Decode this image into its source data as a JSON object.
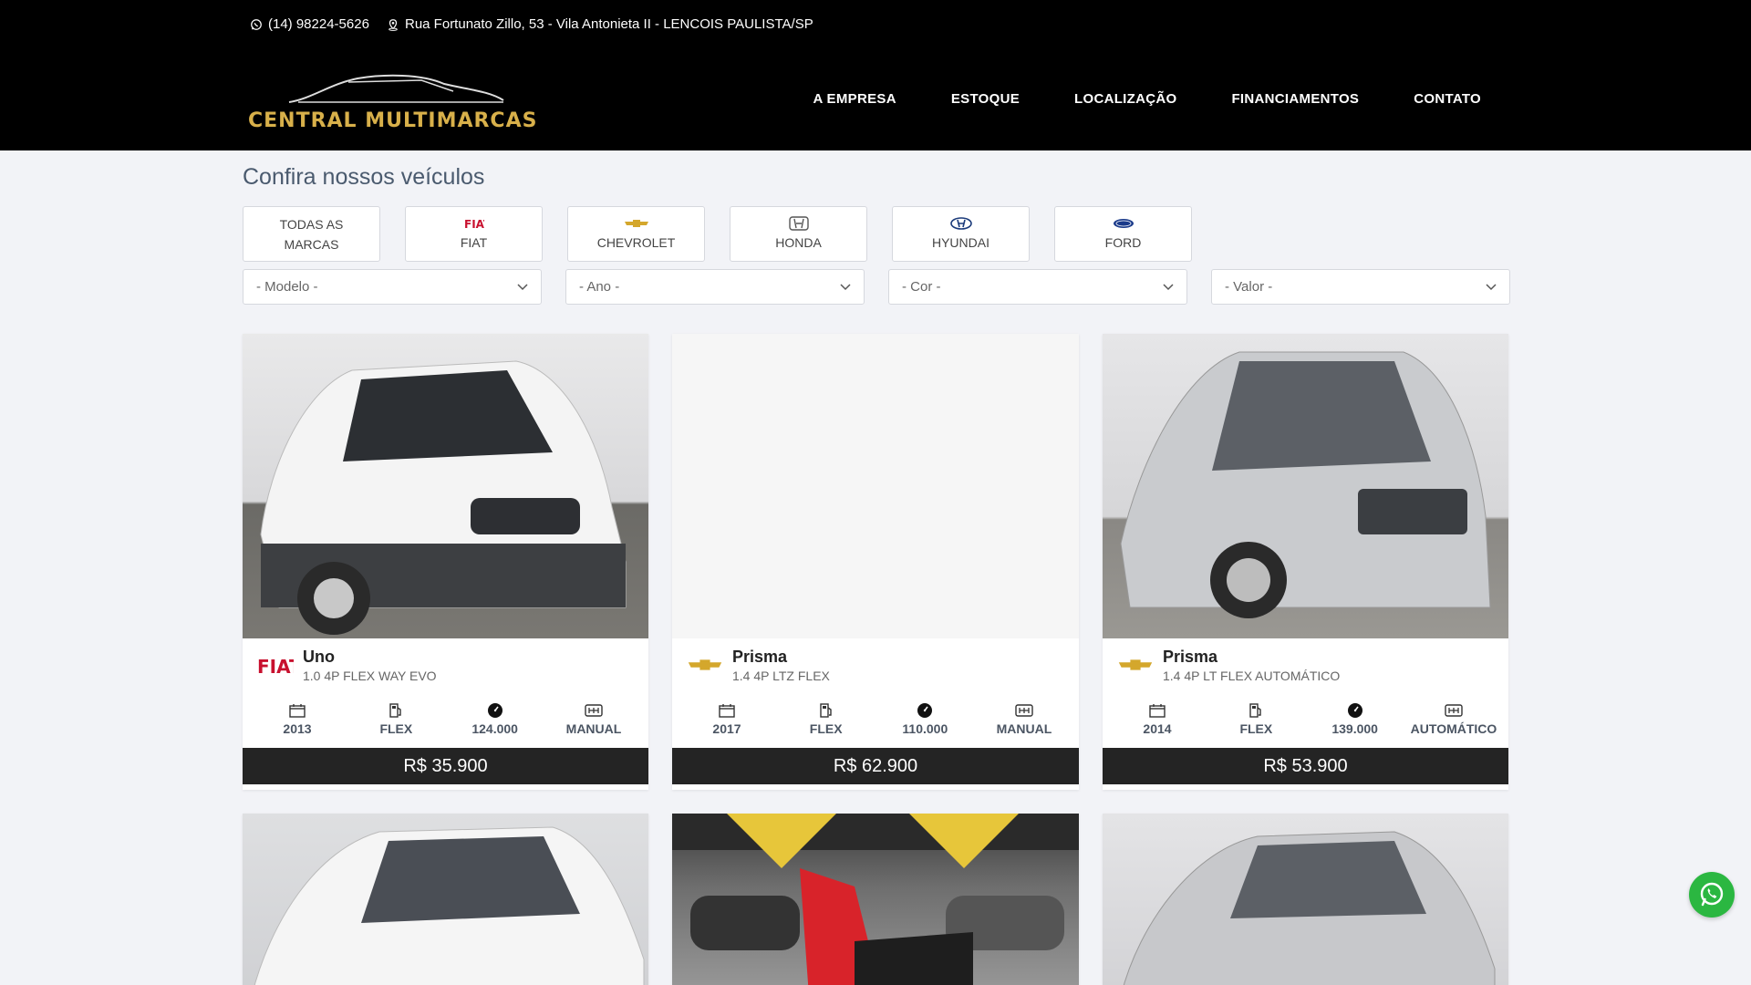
{
  "header": {
    "phone": "(14) 98224-5626",
    "address": "Rua Fortunato Zillo, 53 - Vila Antonieta II - LENCOIS PAULISTA/SP",
    "logo_text": "CENTRAL MULTIMARCAS",
    "nav": [
      "A EMPRESA",
      "ESTOQUE",
      "LOCALIZAÇÃO",
      "FINANCIAMENTOS",
      "CONTATO"
    ]
  },
  "main": {
    "title": "Confira nossos veículos",
    "brands": [
      {
        "label_1": "TODAS AS",
        "label_2": "MARCAS",
        "icon": "none"
      },
      {
        "label_2": "FIAT",
        "icon": "fiat-logo-icon"
      },
      {
        "label_2": "CHEVROLET",
        "icon": "chevrolet-logo-icon"
      },
      {
        "label_2": "HONDA",
        "icon": "honda-logo-icon"
      },
      {
        "label_2": "HYUNDAI",
        "icon": "hyundai-logo-icon"
      },
      {
        "label_2": "FORD",
        "icon": "ford-logo-icon"
      }
    ],
    "filters": [
      "- Modelo -",
      "- Ano -",
      "- Cor -",
      "- Valor -"
    ]
  },
  "cars": [
    {
      "model": "Uno",
      "version": "1.0 4P FLEX WAY EVO",
      "brand": "fiat-logo-icon",
      "year": "2013",
      "fuel": "FLEX",
      "km": "124.000",
      "gear": "MANUAL",
      "price": "R$ 35.900"
    },
    {
      "model": "Prisma",
      "version": "1.4 4P LTZ FLEX",
      "brand": "chevrolet-logo-icon",
      "year": "2017",
      "fuel": "FLEX",
      "km": "110.000",
      "gear": "MANUAL",
      "price": "R$ 62.900"
    },
    {
      "model": "Prisma",
      "version": "1.4 4P LT FLEX AUTOMÁTICO",
      "brand": "chevrolet-logo-icon",
      "year": "2014",
      "fuel": "FLEX",
      "km": "139.000",
      "gear": "AUTOMÁTICO",
      "price": "R$ 53.900"
    }
  ],
  "colors": {
    "header_bg": "#000000",
    "logo_gold": "#d8b04a",
    "price_bg": "#242424",
    "whatsapp": "#2bb741",
    "fiat_red": "#c8102e",
    "chevy_gold": "#d4a72c"
  }
}
